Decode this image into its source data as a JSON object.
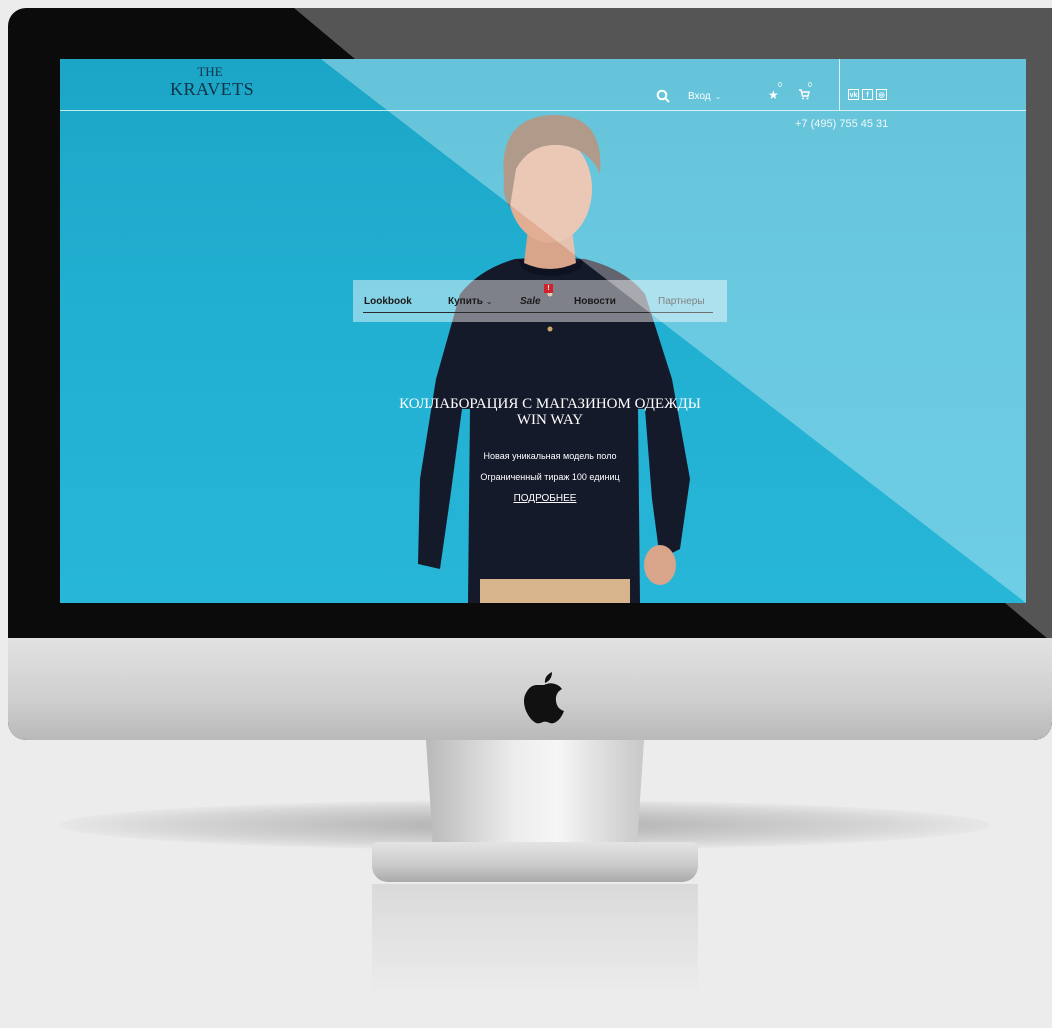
{
  "brand": {
    "the": "THE",
    "name": "KRAVETS"
  },
  "header": {
    "login_label": "Вход",
    "favorites_count": "0",
    "cart_count": "0",
    "socials": [
      "vk",
      "f",
      "ig"
    ],
    "phone": "+7 (495) 755 45 31"
  },
  "menu": {
    "items": [
      "Lookbook",
      "Купить",
      "Sale",
      "Новости",
      "Партнеры"
    ],
    "sale_badge": "!"
  },
  "hero": {
    "title_line1": "КОЛЛАБОРАЦИЯ С МАГАЗИНОМ ОДЕЖДЫ",
    "title_line2": "WIN WAY",
    "line1": "Новая уникальная модель поло",
    "line2": "Ограниченный тираж 100 единиц",
    "more": "ПОДРОБНЕЕ"
  },
  "colors": {
    "screen_bg": "#22b0d2",
    "logo": "#0f3347",
    "sale_badge": "#d0222a",
    "shirt": "#151a2b"
  }
}
